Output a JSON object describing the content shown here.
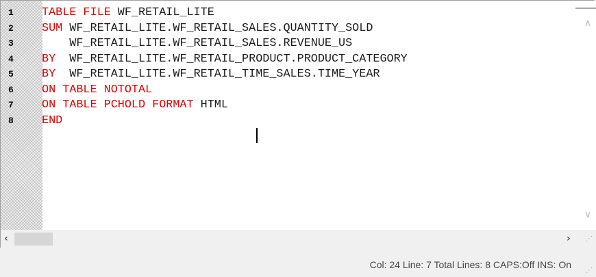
{
  "editor": {
    "line_numbers": [
      "1",
      "2",
      "3",
      "4",
      "5",
      "6",
      "7",
      "8"
    ],
    "lines": [
      [
        {
          "t": "TABLE FILE ",
          "kw": true
        },
        {
          "t": "WF_RETAIL_LITE",
          "kw": false
        }
      ],
      [
        {
          "t": "SUM ",
          "kw": true
        },
        {
          "t": "WF_RETAIL_LITE.WF_RETAIL_SALES.QUANTITY_SOLD",
          "kw": false
        }
      ],
      [
        {
          "t": "    WF_RETAIL_LITE.WF_RETAIL_SALES.REVENUE_US",
          "kw": false
        }
      ],
      [
        {
          "t": "BY  ",
          "kw": true
        },
        {
          "t": "WF_RETAIL_LITE.WF_RETAIL_PRODUCT.PRODUCT_CATEGORY",
          "kw": false
        }
      ],
      [
        {
          "t": "BY  ",
          "kw": true
        },
        {
          "t": "WF_RETAIL_LITE.WF_RETAIL_TIME_SALES.TIME_YEAR",
          "kw": false
        }
      ],
      [
        {
          "t": "ON TABLE NOTOTAL",
          "kw": true
        }
      ],
      [
        {
          "t": "ON TABLE PCHOLD FORMAT ",
          "kw": true
        },
        {
          "t": "HTML",
          "kw": false
        }
      ],
      [
        {
          "t": "END",
          "kw": true
        }
      ]
    ],
    "keyword_color": "#e10000",
    "text_color": "#1a1a1a"
  },
  "scrollbars": {
    "vertical_up_icon": "chevron-up-icon",
    "vertical_down_icon": "chevron-down-icon",
    "horizontal_left_icon": "chevron-left-icon",
    "horizontal_right_icon": "chevron-right-icon"
  },
  "statusbar": {
    "text": "Col: 24 Line: 7 Total Lines: 8 CAPS:Off INS: On"
  }
}
